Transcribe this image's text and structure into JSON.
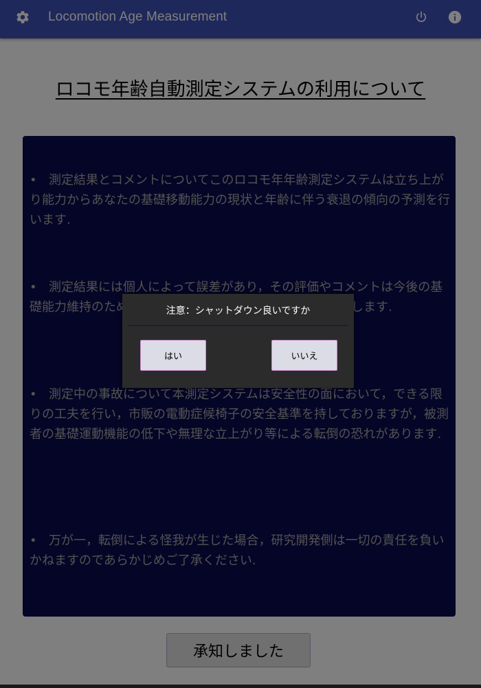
{
  "app": {
    "title": "Locomotion Age Measurement",
    "accent": "#3f51b5"
  },
  "icons": {
    "settings": "gear-icon",
    "power": "power-icon",
    "info": "info-icon"
  },
  "page": {
    "title": "ロコモ年齢自動測定システムの利用について",
    "paragraphs": [
      "測定結果とコメントについてこのロコモ年年齢測定システムは立ち上がり能力からあなたの基礎移動能力の現状と年齢に伴う衰退の傾向の予測を行います.",
      "測定結果には個人によって誤差があり，その評価やコメントは今後の基礎能力維持のための参考程度にお考えいただくようお願いします.",
      "測定中の事故について本測定システムは安全性の面において，できる限りの工夫を行い，市販の電動症候椅子の安全基準を持しておりますが，被測者の基礎運動機能の低下や無理な立上がり等による転倒の恐れがあります.",
      "万が一，転倒による怪我が生じた場合，研究開発側は一切の責任を負いかねますのであらかじめご了承ください."
    ],
    "bullet": "•",
    "accept_label": "承知しました",
    "terms_background": "#0a0a4f"
  },
  "dialog": {
    "message": "注意：シャットダウン良いですか",
    "yes_label": "はい",
    "no_label": "いいえ"
  }
}
